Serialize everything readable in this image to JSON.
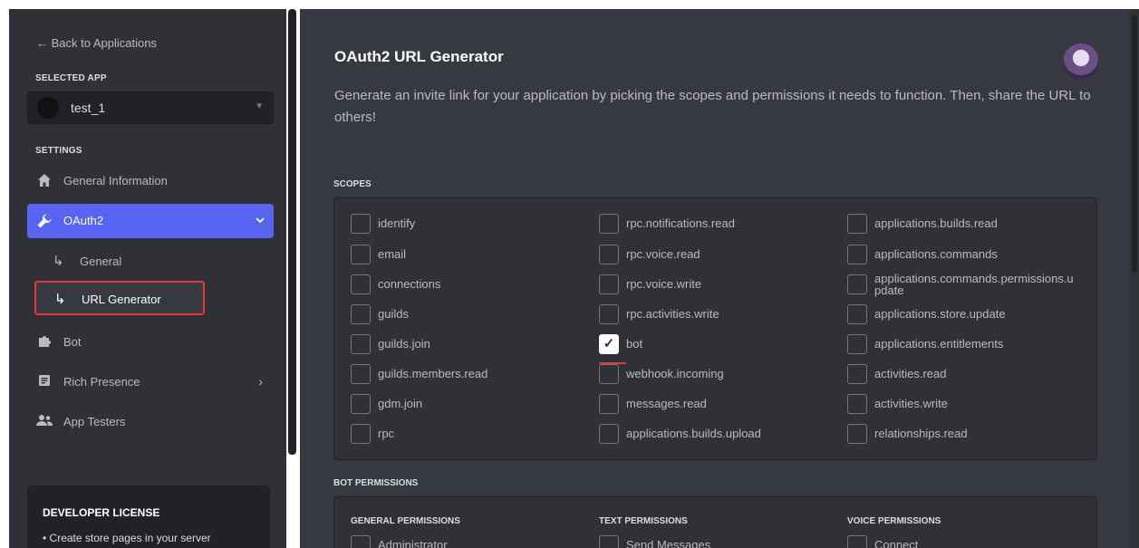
{
  "sidebar": {
    "back_label": "← Back to Applications",
    "selected_app_label": "SELECTED APP",
    "app_name": "test_1",
    "settings_label": "SETTINGS",
    "nav": {
      "general_information": "General Information",
      "oauth2": "OAuth2",
      "oauth2_general": "General",
      "url_generator": "URL Generator",
      "bot": "Bot",
      "rich_presence": "Rich Presence",
      "app_testers": "App Testers"
    },
    "license": {
      "title": "DEVELOPER LICENSE",
      "line": "• Create store pages in your server"
    }
  },
  "main": {
    "title": "OAuth2 URL Generator",
    "description": "Generate an invite link for your application by picking the scopes and permissions it needs to function. Then, share the URL to others!",
    "scopes_label": "SCOPES",
    "scopes": [
      [
        "identify",
        "email",
        "connections",
        "guilds",
        "guilds.join",
        "guilds.members.read",
        "gdm.join",
        "rpc"
      ],
      [
        "rpc.notifications.read",
        "rpc.voice.read",
        "rpc.voice.write",
        "rpc.activities.write",
        "bot",
        "webhook.incoming",
        "messages.read",
        "applications.builds.upload"
      ],
      [
        "applications.builds.read",
        "applications.commands",
        "applications.commands.permissions.u pdate",
        "applications.store.update",
        "applications.entitlements",
        "activities.read",
        "activities.write",
        "relationships.read"
      ]
    ],
    "checked_scopes": [
      "bot"
    ],
    "bot_permissions_label": "BOT PERMISSIONS",
    "permission_groups": [
      {
        "title": "GENERAL PERMISSIONS",
        "first": "Administrator"
      },
      {
        "title": "TEXT PERMISSIONS",
        "first": "Send Messages"
      },
      {
        "title": "VOICE PERMISSIONS",
        "first": "Connect"
      }
    ]
  },
  "colors": {
    "accent": "#5865f2",
    "highlight": "#e53935",
    "sidebar_bg": "#2f3136",
    "main_bg": "#36393f"
  },
  "icons": {
    "home": "home-icon",
    "oauth2": "wrench-icon",
    "bot": "puzzle-icon",
    "rich_presence": "document-icon",
    "app_testers": "users-icon"
  }
}
